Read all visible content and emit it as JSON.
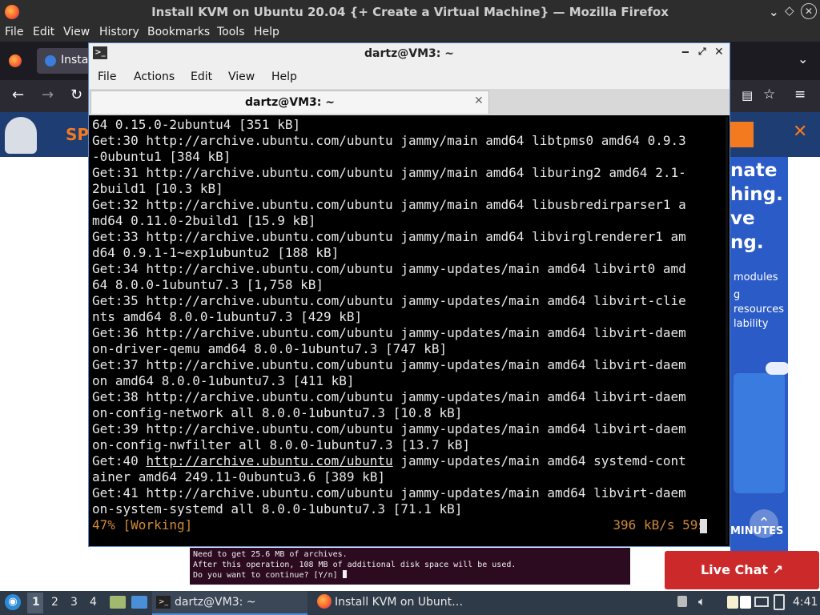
{
  "firefox": {
    "window_title": "Install KVM on Ubuntu 20.04 {+ Create a Virtual Machine} — Mozilla Firefox",
    "menu": [
      "File",
      "Edit",
      "View",
      "History",
      "Bookmarks",
      "Tools",
      "Help"
    ],
    "tab_label": "Insta"
  },
  "banner": {
    "partial_text": "SP"
  },
  "ad": {
    "lines": [
      "nate",
      "hing.",
      "ve",
      "ng."
    ],
    "small": [
      "modules",
      "g",
      "resources",
      "lability"
    ],
    "minutes": "MINUTES"
  },
  "terminal": {
    "window_title": "dartz@VM3: ~",
    "menu": [
      "File",
      "Actions",
      "Edit",
      "View",
      "Help"
    ],
    "tab_label": "dartz@VM3: ~",
    "lines": [
      "64 0.15.0-2ubuntu4 [351 kB]",
      "Get:30 http://archive.ubuntu.com/ubuntu jammy/main amd64 libtpms0 amd64 0.9.3",
      "-0ubuntu1 [384 kB]",
      "Get:31 http://archive.ubuntu.com/ubuntu jammy/main amd64 liburing2 amd64 2.1-",
      "2build1 [10.3 kB]",
      "Get:32 http://archive.ubuntu.com/ubuntu jammy/main amd64 libusbredirparser1 a",
      "md64 0.11.0-2build1 [15.9 kB]",
      "Get:33 http://archive.ubuntu.com/ubuntu jammy/main amd64 libvirglrenderer1 am",
      "d64 0.9.1-1~exp1ubuntu2 [188 kB]",
      "Get:34 http://archive.ubuntu.com/ubuntu jammy-updates/main amd64 libvirt0 amd",
      "64 8.0.0-1ubuntu7.3 [1,758 kB]",
      "Get:35 http://archive.ubuntu.com/ubuntu jammy-updates/main amd64 libvirt-clie",
      "nts amd64 8.0.0-1ubuntu7.3 [429 kB]",
      "Get:36 http://archive.ubuntu.com/ubuntu jammy-updates/main amd64 libvirt-daem",
      "on-driver-qemu amd64 8.0.0-1ubuntu7.3 [747 kB]",
      "Get:37 http://archive.ubuntu.com/ubuntu jammy-updates/main amd64 libvirt-daem",
      "on amd64 8.0.0-1ubuntu7.3 [411 kB]",
      "Get:38 http://archive.ubuntu.com/ubuntu jammy-updates/main amd64 libvirt-daem",
      "on-config-network all 8.0.0-1ubuntu7.3 [10.8 kB]",
      "Get:39 http://archive.ubuntu.com/ubuntu jammy-updates/main amd64 libvirt-daem",
      "on-config-nwfilter all 8.0.0-1ubuntu7.3 [13.7 kB]",
      "Get:40 http://archive.ubuntu.com/ubuntu jammy-updates/main amd64 systemd-cont",
      "ainer amd64 249.11-0ubuntu3.6 [389 kB]",
      "Get:41 http://archive.ubuntu.com/ubuntu jammy-updates/main amd64 libvirt-daem",
      "on-system-systemd all 8.0.0-1ubuntu7.3 [71.1 kB]"
    ],
    "status_left": "47% [Working]",
    "status_right": "396 kB/s 59s",
    "status_color": "#d0893a"
  },
  "background_terminal": {
    "lines": [
      "Need to get 25.6 MB of archives.",
      "After this operation, 108 MB of additional disk space will be used.",
      "Do you want to continue? [Y/n] "
    ]
  },
  "live_chat": {
    "label": "Live Chat ↗"
  },
  "taskbar": {
    "workspaces": [
      "1",
      "2",
      "3",
      "4"
    ],
    "tasks": [
      "dartz@VM3: ~",
      "Install KVM on Ubunt…"
    ],
    "clock": "4:41"
  },
  "colors": {
    "accent_orange": "#f47a20",
    "close_x": "#f47a20",
    "live_chat_red": "#cc2a2a"
  }
}
